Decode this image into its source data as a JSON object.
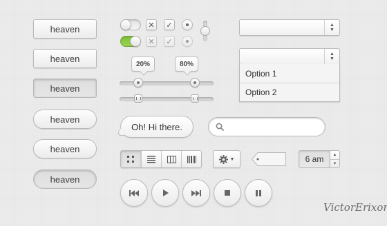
{
  "buttons": {
    "rect_normal": "heaven",
    "rect_hover": "heaven",
    "rect_pressed": "heaven",
    "pill_normal": "heaven",
    "pill_hover": "heaven",
    "pill_pressed": "heaven"
  },
  "toggles": {
    "off_state": "off",
    "on_state": "on",
    "on_color": "#8bcb44"
  },
  "sliders": {
    "tooltip_left": "20%",
    "tooltip_right": "80%",
    "range_low": 20,
    "range_high": 80
  },
  "speech_bubble": {
    "text": "Oh! Hi there."
  },
  "search": {
    "placeholder": "",
    "value": ""
  },
  "select": {
    "closed_value": "",
    "open_value": ""
  },
  "dropdown": {
    "options": [
      "Option 1",
      "Option 2"
    ]
  },
  "view_switcher": {
    "icons": [
      "grid-icon",
      "list-icon",
      "columns-icon",
      "barcode-icon"
    ],
    "active_index": 0
  },
  "time_stepper": {
    "value": "6 am"
  },
  "media_controls": {
    "icons": [
      "rewind-icon",
      "play-icon",
      "fast-forward-icon",
      "stop-icon",
      "pause-icon"
    ]
  },
  "signature": {
    "text": "VictorErixon"
  }
}
